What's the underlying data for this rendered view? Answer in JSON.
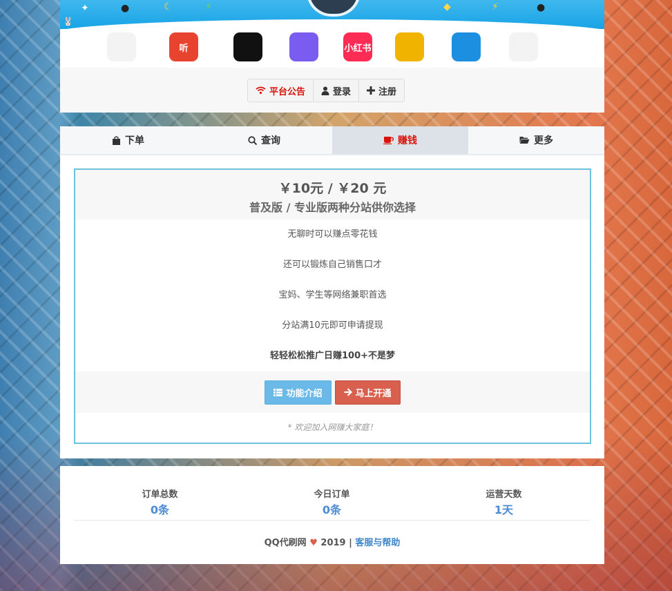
{
  "banner": {
    "app_icons": [
      {
        "name": "quanmin-k-song-icon",
        "label": "",
        "color": "#f3f3f3"
      },
      {
        "name": "ximalaya-ting-icon",
        "label": "听",
        "color": "#e8432e"
      },
      {
        "name": "video-play-icon",
        "label": "",
        "color": "#111111"
      },
      {
        "name": "weishi-video-icon",
        "label": "",
        "color": "#7b5cf0"
      },
      {
        "name": "xiaohongshu-icon",
        "label": "小红书",
        "color": "#fe2c55"
      },
      {
        "name": "qq-show-icon",
        "label": "",
        "color": "#f0b400"
      },
      {
        "name": "qq-zone-icon",
        "label": "",
        "color": "#1d8fe0"
      },
      {
        "name": "qq-penguin-icon",
        "label": "",
        "color": "#f3f3f3"
      }
    ]
  },
  "topnav": {
    "notice": "平台公告",
    "login": "登录",
    "register": "注册"
  },
  "tabs": {
    "order": "下单",
    "query": "查询",
    "earn": "赚钱",
    "more": "更多"
  },
  "panel": {
    "price": "￥10元 /  ￥20 元",
    "subtitle": "普及版 / 专业版两种分站供你选择",
    "lines": [
      "无聊时可以赚点零花钱",
      "还可以锻炼自己销售口才",
      "宝妈、学生等网络兼职首选",
      "分站满10元即可申请提现"
    ],
    "highlight": "轻轻松松推广日赚100+不是梦",
    "intro_button": "功能介绍",
    "open_button": "马上开通",
    "note": "* 欢迎加入网赚大家庭！"
  },
  "stats": {
    "total_label": "订单总数",
    "total_value": "0条",
    "today_label": "今日订单",
    "today_value": "0条",
    "days_label": "运营天数",
    "days_value": "1天"
  },
  "footer": {
    "site": "QQ代刷网",
    "year": "2019",
    "sep": "|",
    "help": "客服与帮助"
  },
  "colors": {
    "accent_red": "#d9140b",
    "info_blue": "#6ab9e8",
    "danger_red": "#d9604e",
    "stat_blue": "#4c8bd6",
    "panel_border": "#6bc3db"
  }
}
